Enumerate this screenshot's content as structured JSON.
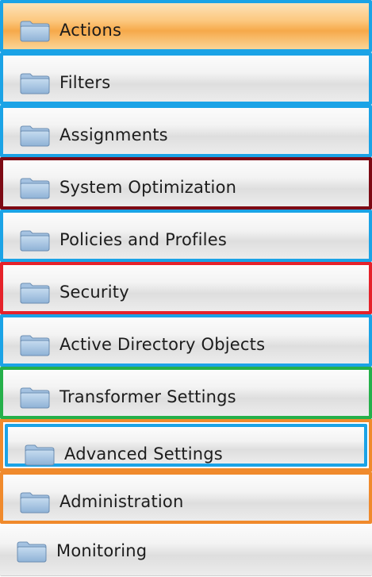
{
  "nav": {
    "items": [
      {
        "label": "Actions",
        "icon": "folder-icon",
        "border": "#1ba3e6",
        "active": true
      },
      {
        "label": "Filters",
        "icon": "folder-icon",
        "border": "#1ba3e6",
        "active": false
      },
      {
        "label": "Assignments",
        "icon": "folder-icon",
        "border": "#1ba3e6",
        "active": false
      },
      {
        "label": "System Optimization",
        "icon": "folder-icon",
        "border": "#7d0a14",
        "active": false
      },
      {
        "label": "Policies and Profiles",
        "icon": "folder-icon",
        "border": "#1ba3e6",
        "active": false
      },
      {
        "label": "Security",
        "icon": "folder-icon",
        "border": "#e5222a",
        "active": false
      },
      {
        "label": "Active Directory Objects",
        "icon": "folder-icon",
        "border": "#1ba3e6",
        "active": false
      },
      {
        "label": "Transformer Settings",
        "icon": "folder-icon",
        "border": "#25b04a",
        "active": false
      },
      {
        "label": "Advanced Settings",
        "icon": "folder-icon",
        "border": "#1ba3e6",
        "outer_border": "#f08a2c",
        "active": false
      },
      {
        "label": "Administration",
        "icon": "folder-icon",
        "border": "#f08a2c",
        "active": false
      },
      {
        "label": "Monitoring",
        "icon": "folder-icon",
        "border": "",
        "active": false
      }
    ]
  }
}
